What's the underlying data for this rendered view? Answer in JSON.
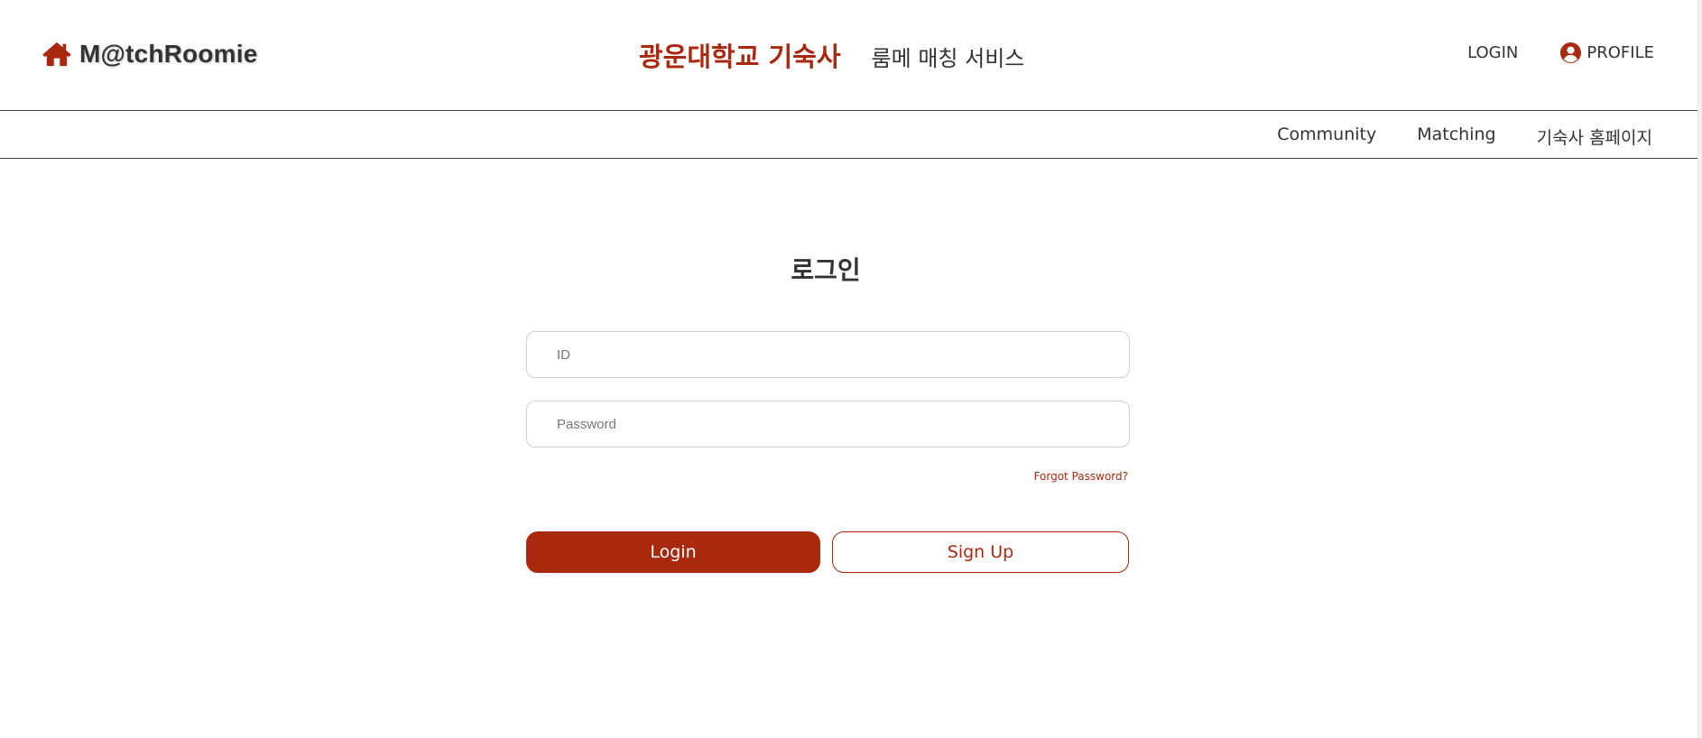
{
  "header": {
    "logo_text": "M@tchRoomie",
    "title_main": "광운대학교 기숙사",
    "title_sub": "룸메 매칭 서비스",
    "login_label": "LOGIN",
    "profile_label": "PROFILE"
  },
  "subnav": {
    "items": [
      {
        "label": "Community"
      },
      {
        "label": "Matching"
      },
      {
        "label": "기숙사 홈페이지"
      }
    ]
  },
  "login_form": {
    "title": "로그인",
    "id_placeholder": "ID",
    "password_placeholder": "Password",
    "forgot_label": "Forgot Password?",
    "login_button": "Login",
    "signup_button": "Sign Up"
  },
  "colors": {
    "accent": "#a9290f",
    "text": "#333333",
    "border": "#cfcfcf"
  },
  "icons": {
    "logo": "home-icon",
    "profile": "user-circle-icon"
  }
}
